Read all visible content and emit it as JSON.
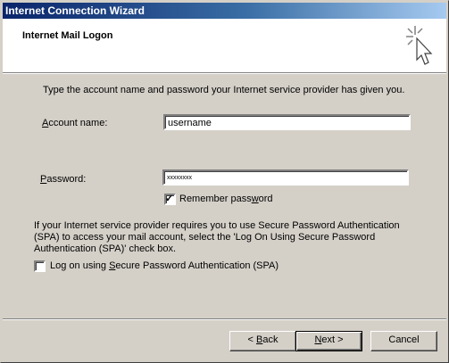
{
  "window": {
    "title": "Internet Connection Wizard"
  },
  "header": {
    "title": "Internet Mail Logon",
    "icon": "wizard-sparkle-cursor-icon"
  },
  "intro_text": "Type the account name and password your Internet service provider has given you.",
  "account": {
    "label_mnemonic": "A",
    "label_rest": "ccount name:",
    "value": "username"
  },
  "password": {
    "label_mnemonic": "P",
    "label_rest": "assword:",
    "value": "xxxxxxxx"
  },
  "remember": {
    "label_before": "Remember pass",
    "label_mnemonic": "w",
    "label_after": "ord",
    "checked": true
  },
  "spa_text": {
    "line1": "If your Internet service provider requires you to use Secure Password Authentication",
    "line2": "(SPA) to access your mail account, select the 'Log On Using Secure Password",
    "line3": "Authentication (SPA)' check box."
  },
  "spa_checkbox": {
    "label_before": "Log on using ",
    "label_mnemonic": "S",
    "label_after": "ecure Password Authentication (SPA)",
    "checked": false
  },
  "buttons": {
    "back_prefix": "< ",
    "back_mnemonic": "B",
    "back_rest": "ack",
    "next_mnemonic": "N",
    "next_rest": "ext >",
    "cancel": "Cancel"
  }
}
